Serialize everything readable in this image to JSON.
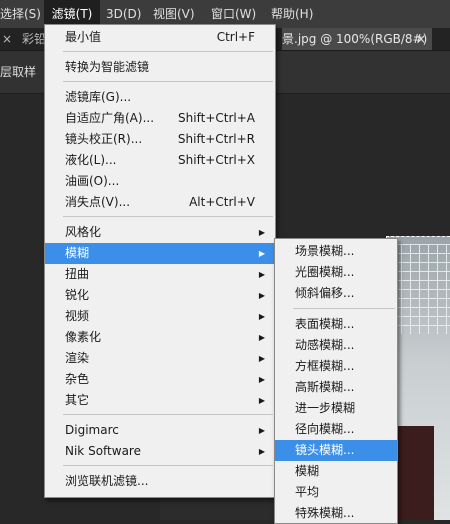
{
  "menubar": {
    "items": [
      "选择(S)",
      "滤镜(T)",
      "3D(D)",
      "视图(V)",
      "窗口(W)",
      "帮助(H)"
    ]
  },
  "tabs": {
    "left_partial": "彩铅",
    "doc_title": "景.jpg @ 100%(RGB/8#)",
    "close_glyph": "×"
  },
  "options": {
    "label": "层取样"
  },
  "filter_menu": {
    "last_filter": {
      "label": "最小值",
      "shortcut": "Ctrl+F"
    },
    "convert_smart": {
      "label": "转换为智能滤镜"
    },
    "gallery": {
      "label": "滤镜库(G)..."
    },
    "adaptive_wide": {
      "label": "自适应广角(A)...",
      "shortcut": "Shift+Ctrl+A"
    },
    "lens_correction": {
      "label": "镜头校正(R)...",
      "shortcut": "Shift+Ctrl+R"
    },
    "liquify": {
      "label": "液化(L)...",
      "shortcut": "Shift+Ctrl+X"
    },
    "oil_paint": {
      "label": "油画(O)..."
    },
    "vanishing_point": {
      "label": "消失点(V)...",
      "shortcut": "Alt+Ctrl+V"
    },
    "stylize": {
      "label": "风格化"
    },
    "blur": {
      "label": "模糊"
    },
    "distort": {
      "label": "扭曲"
    },
    "sharpen": {
      "label": "锐化"
    },
    "video": {
      "label": "视频"
    },
    "pixelate": {
      "label": "像素化"
    },
    "render": {
      "label": "渲染"
    },
    "noise": {
      "label": "杂色"
    },
    "other": {
      "label": "其它"
    },
    "digimarc": {
      "label": "Digimarc"
    },
    "nik": {
      "label": "Nik Software"
    },
    "browse_online": {
      "label": "浏览联机滤镜..."
    }
  },
  "blur_submenu": {
    "field_blur": "场景模糊...",
    "iris_blur": "光圈模糊...",
    "tilt_shift": "倾斜偏移...",
    "surface_blur": "表面模糊...",
    "motion_blur": "动感模糊...",
    "box_blur": "方框模糊...",
    "gaussian_blur": "高斯模糊...",
    "further_blur": "进一步模糊",
    "radial_blur": "径向模糊...",
    "lens_blur": "镜头模糊...",
    "blur": "模糊",
    "average": "平均",
    "special_blur": "特殊模糊..."
  },
  "colors": {
    "highlight": "#3c8fe8",
    "menu_bg": "#f0f0f0",
    "menubar_bg": "#3c3c3c"
  }
}
